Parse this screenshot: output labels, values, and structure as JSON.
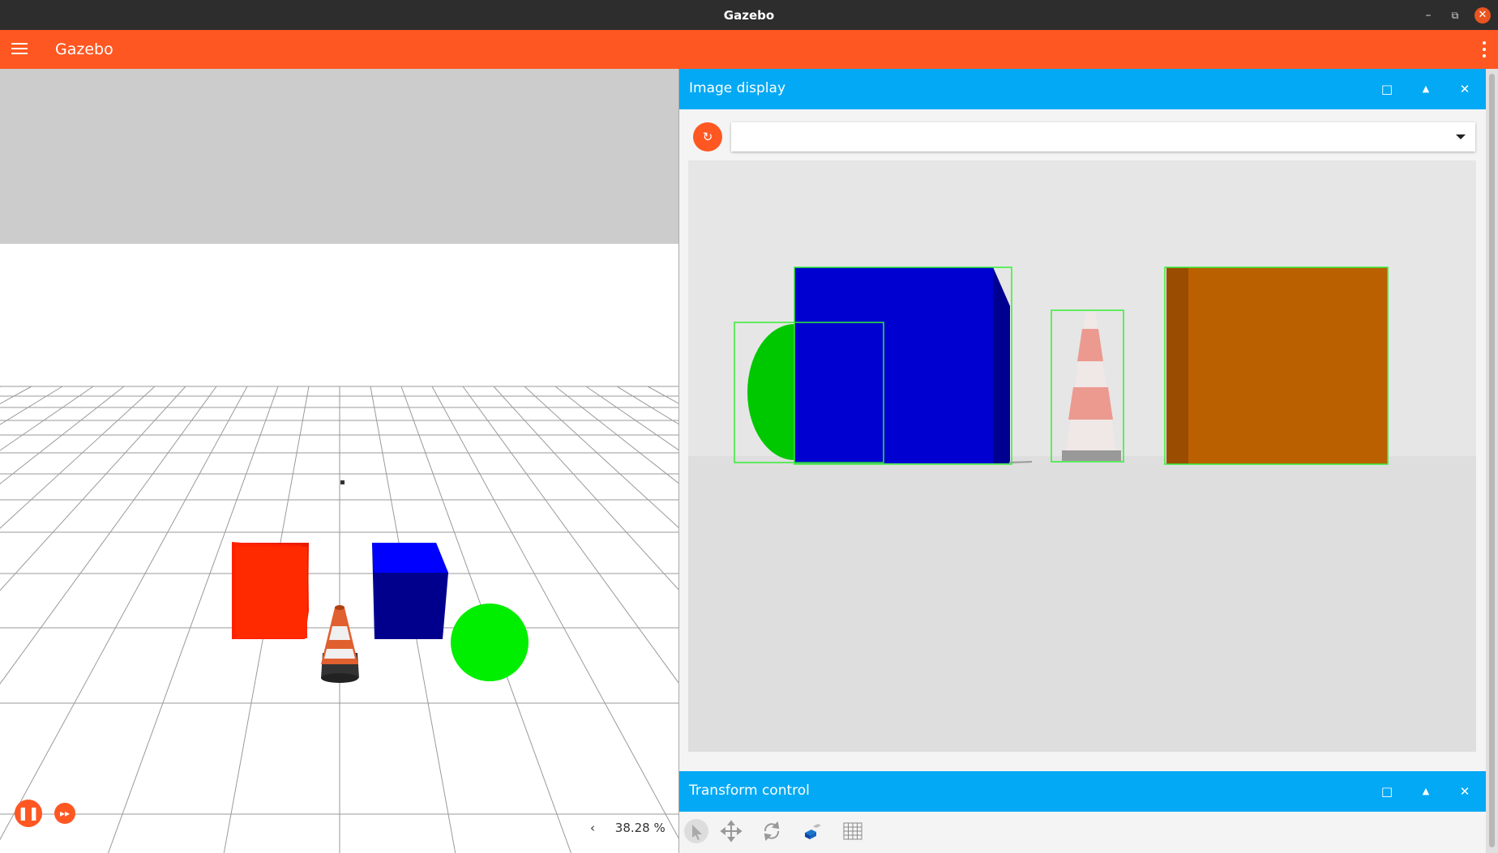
{
  "window": {
    "title": "Gazebo",
    "minimize_glyph": "–",
    "restore_glyph": "⧉",
    "close_glyph": "✕"
  },
  "app": {
    "title": "Gazebo",
    "menu_icon": "hamburger-menu-icon",
    "more_icon": "kebab-menu-icon",
    "accent": "#ff5722"
  },
  "scene": {
    "sky_color": "#cccccc",
    "ground_color": "#ffffff",
    "playback": {
      "pause_glyph": "❚❚",
      "step_glyph": "▸▸"
    },
    "real_time_factor_arrow": "‹",
    "real_time_factor": "38.28 %"
  },
  "image_display": {
    "title": "Image display",
    "header_color": "#03a9f4",
    "refresh_glyph": "↻",
    "topic_value": "",
    "buttons": {
      "maximize_glyph": "□",
      "collapse_glyph": "▲",
      "close_glyph": "✕"
    }
  },
  "transform_control": {
    "title": "Transform control",
    "buttons": {
      "maximize_glyph": "□",
      "collapse_glyph": "▲",
      "close_glyph": "✕"
    },
    "tools": [
      "select-icon",
      "translate-icon",
      "rotate-icon",
      "snap-icon",
      "grid-icon"
    ]
  }
}
